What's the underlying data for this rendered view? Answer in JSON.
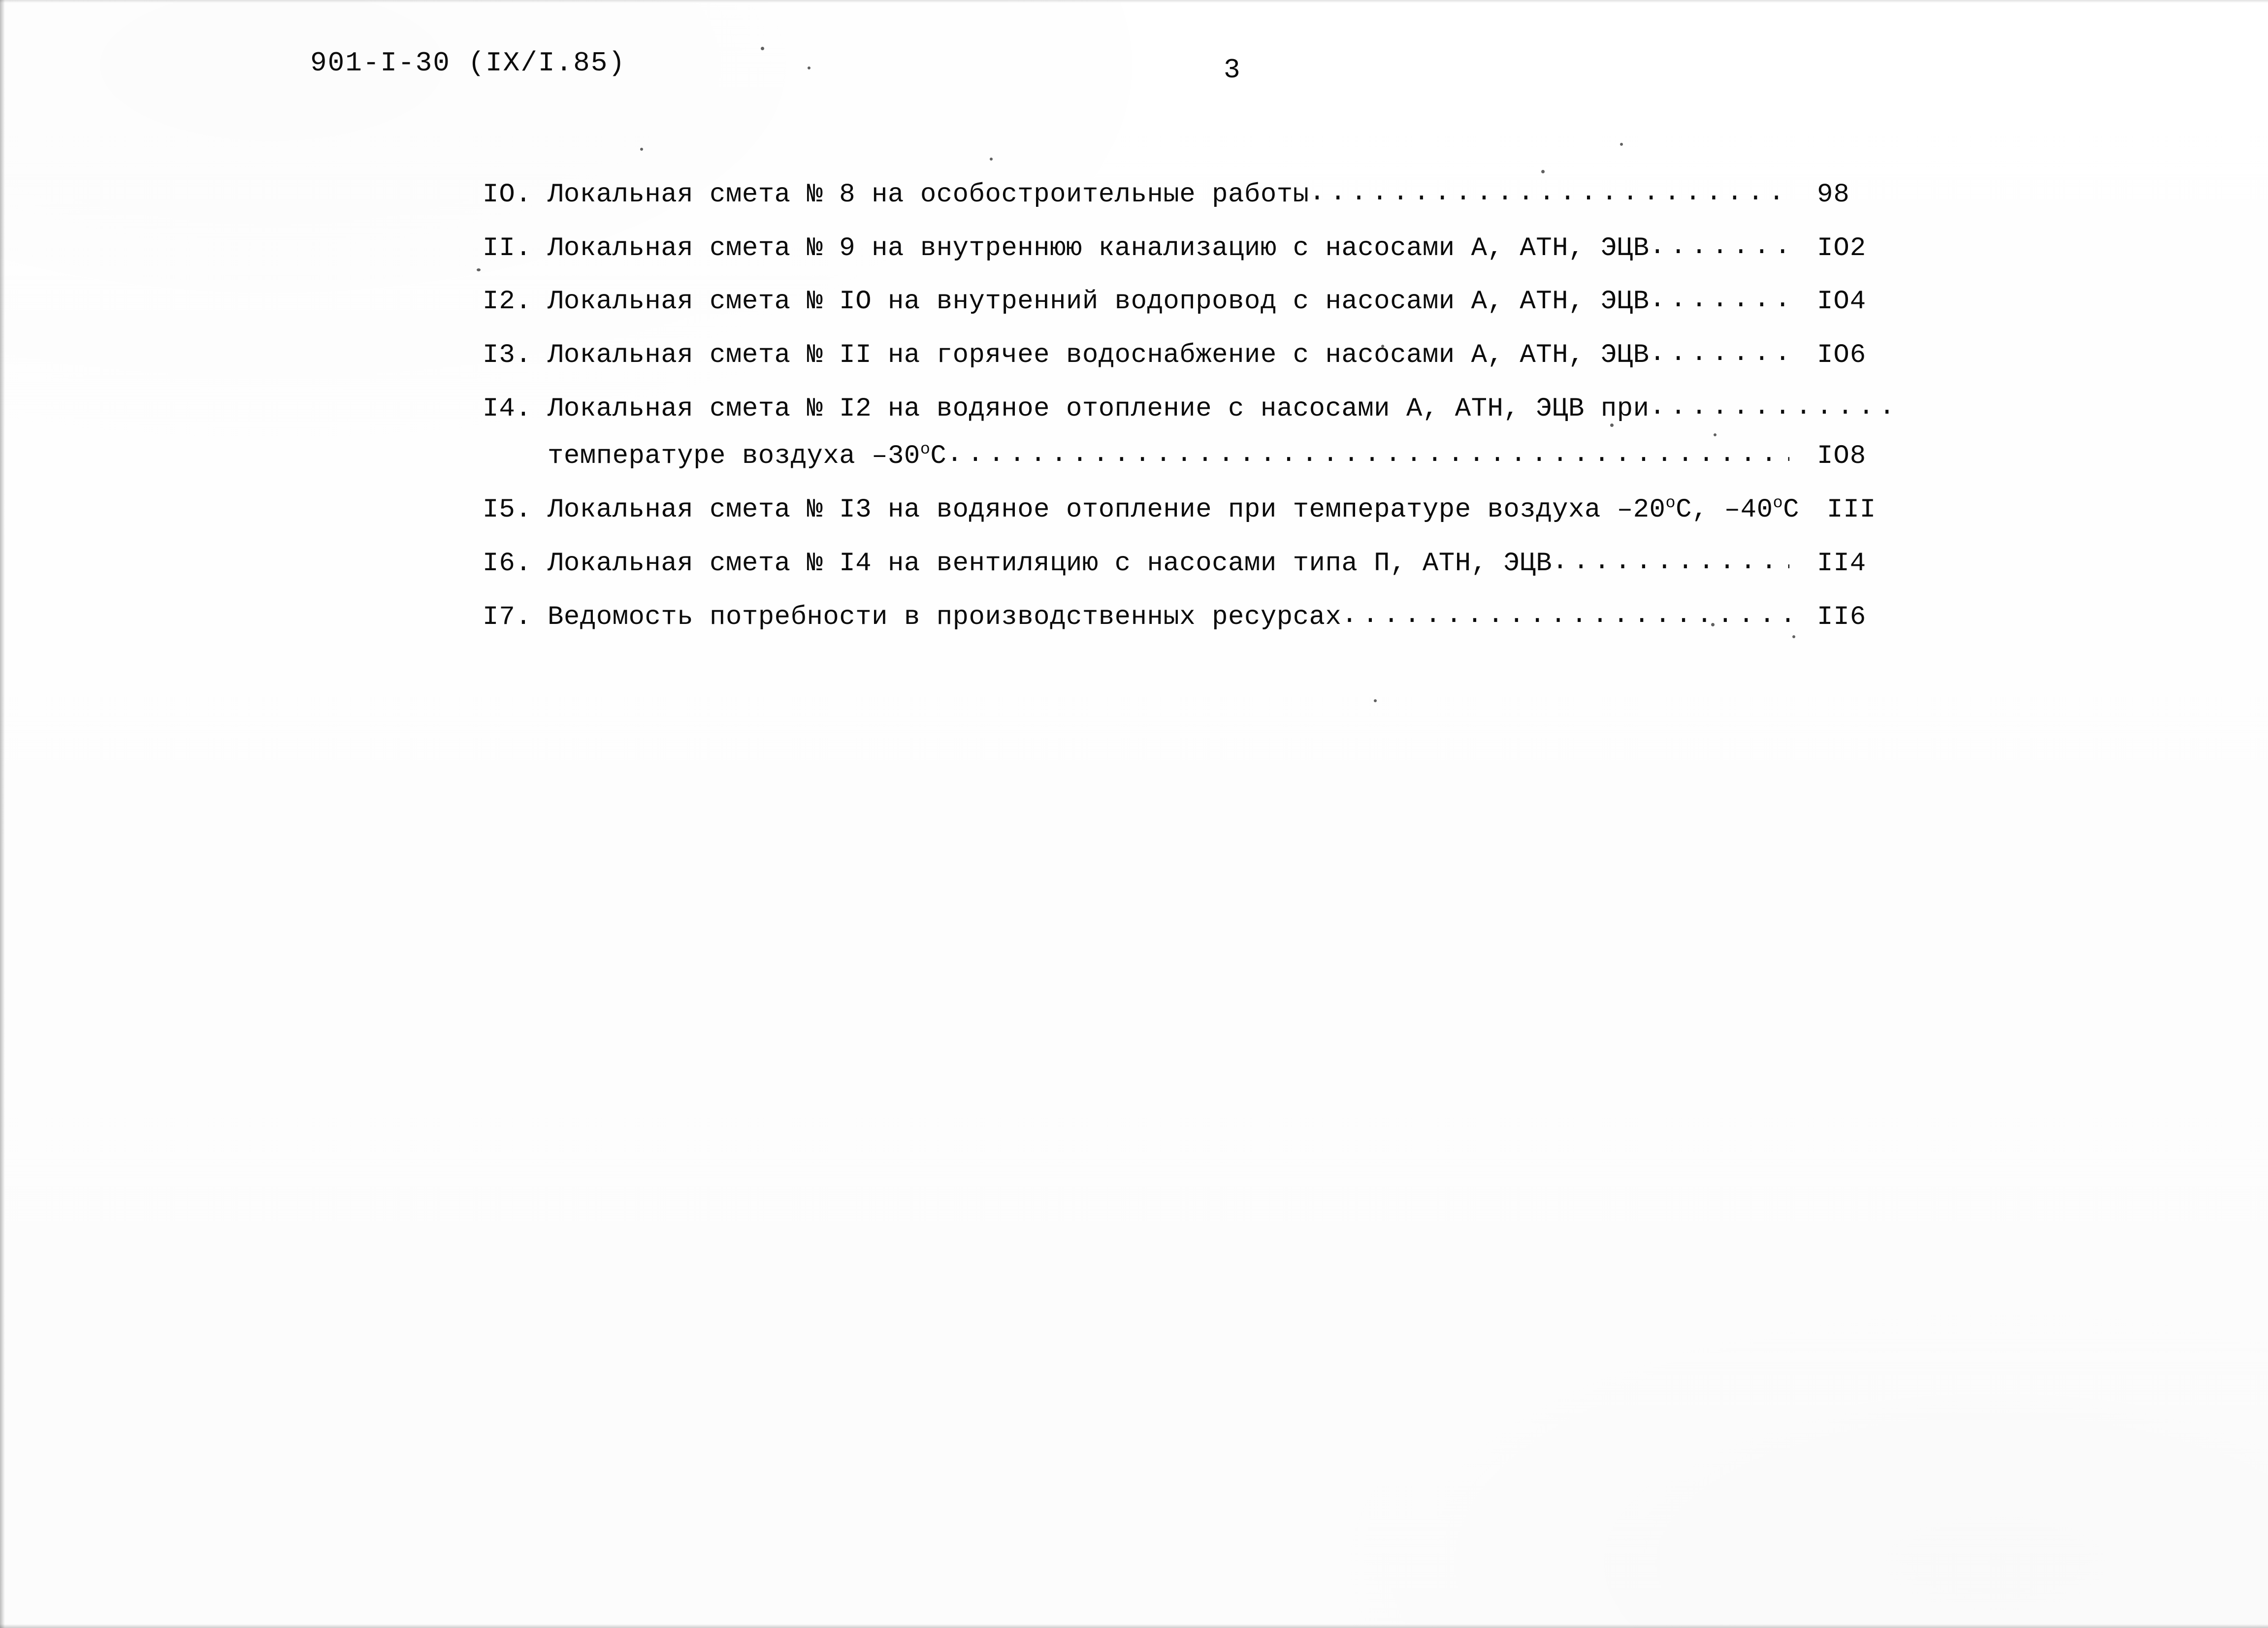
{
  "header": {
    "document_code": "901-I-30 (IX/I.85)",
    "page_number": "3"
  },
  "toc": {
    "entries": [
      {
        "number": "IO.",
        "title": "Локальная смета № 8 на особостроительные работы",
        "page": "98"
      },
      {
        "number": "II.",
        "title": "Локальная смета № 9 на внутреннюю канализацию с насосами А, АТН, ЭЦВ",
        "page": "IO2"
      },
      {
        "number": "I2.",
        "title": "Локальная смета № IO на внутренний водопровод с насосами А, АТН, ЭЦВ",
        "page": "IO4"
      },
      {
        "number": "I3.",
        "title": "Локальная смета № II на горячее водоснабжение с насосами А, АТН, ЭЦВ",
        "page": "IO6"
      },
      {
        "number": "I4.",
        "title": "Локальная смета № I2 на водяное отопление с насосами А, АТН, ЭЦВ при",
        "continuation_prefix": "температуре воздуха –30",
        "continuation_sup": "о",
        "continuation_suffix": "С",
        "page": "IO8"
      },
      {
        "number": "I5.",
        "title_prefix": "Локальная смета № I3 на водяное отопление при температуре воздуха –20",
        "title_sup_1": "о",
        "title_mid": "С, –40",
        "title_sup_2": "о",
        "title_suffix": "С",
        "page": "III"
      },
      {
        "number": "I6.",
        "title": "Локальная смета № I4 на вентиляцию с насосами типа П, АТН, ЭЦВ",
        "page": "II4"
      },
      {
        "number": "I7.",
        "title": "Ведомость потребности в производственных ресурсах",
        "page": "II6"
      }
    ]
  }
}
